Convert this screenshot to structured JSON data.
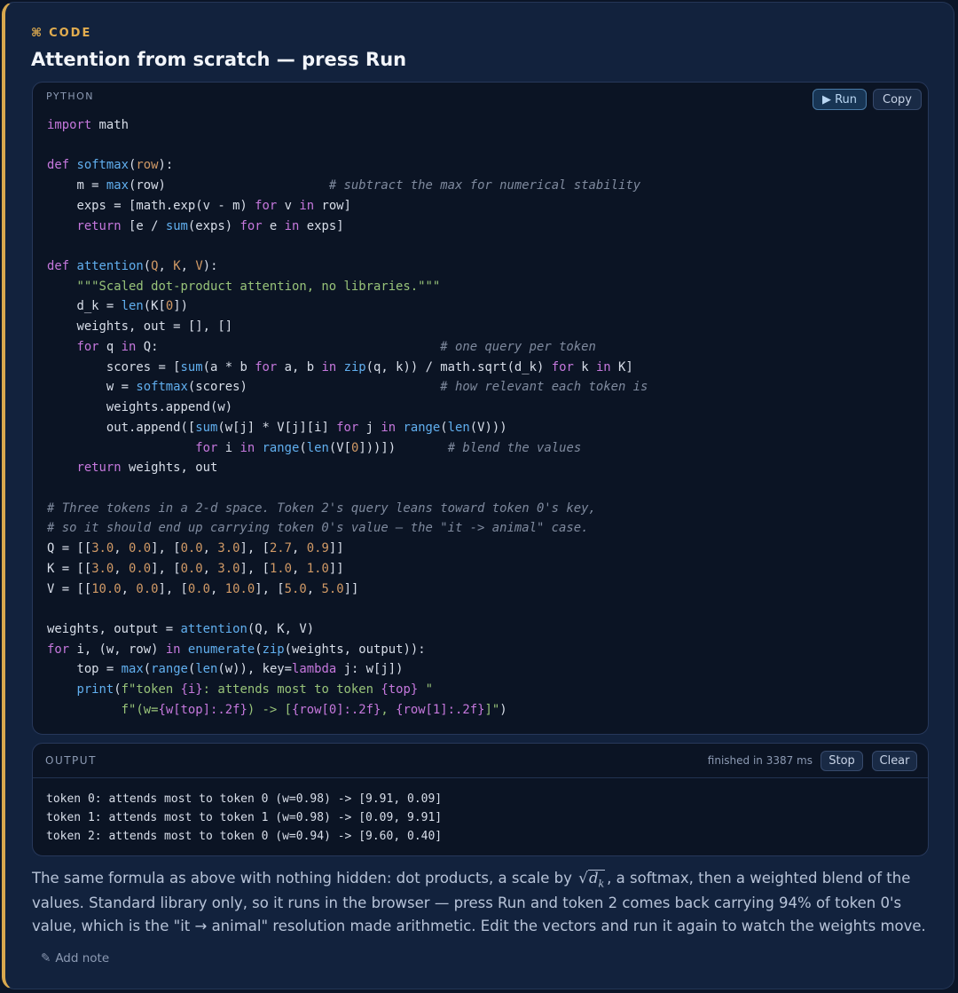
{
  "header": {
    "eyebrow_icon": "⌘",
    "eyebrow": "CODE",
    "title": "Attention from scratch — press Run"
  },
  "code_panel": {
    "language": "PYTHON",
    "run_label": "▶ Run",
    "copy_label": "Copy",
    "lines": [
      "import math",
      "",
      "def softmax(row):",
      "    m = max(row)                      # subtract the max for numerical stability",
      "    exps = [math.exp(v - m) for v in row]",
      "    return [e / sum(exps) for e in exps]",
      "",
      "def attention(Q, K, V):",
      "    \"\"\"Scaled dot-product attention, no libraries.\"\"\"",
      "    d_k = len(K[0])",
      "    weights, out = [], []",
      "    for q in Q:                                      # one query per token",
      "        scores = [sum(a * b for a, b in zip(q, k)) / math.sqrt(d_k) for k in K]",
      "        w = softmax(scores)                          # how relevant each token is",
      "        weights.append(w)",
      "        out.append([sum(w[j] * V[j][i] for j in range(len(V)))",
      "                    for i in range(len(V[0]))])       # blend the values",
      "    return weights, out",
      "",
      "# Three tokens in a 2-d space. Token 2's query leans toward token 0's key,",
      "# so it should end up carrying token 0's value — the \"it -> animal\" case.",
      "Q = [[3.0, 0.0], [0.0, 3.0], [2.7, 0.9]]",
      "K = [[3.0, 0.0], [0.0, 3.0], [1.0, 1.0]]",
      "V = [[10.0, 0.0], [0.0, 10.0], [5.0, 5.0]]",
      "",
      "weights, output = attention(Q, K, V)",
      "for i, (w, row) in enumerate(zip(weights, output)):",
      "    top = max(range(len(w)), key=lambda j: w[j])",
      "    print(f\"token {i}: attends most to token {top} \"",
      "          f\"(w={w[top]:.2f}) -> [{row[0]:.2f}, {row[1]:.2f}]\")"
    ]
  },
  "output_panel": {
    "label": "OUTPUT",
    "status": "finished in 3387 ms",
    "stop_label": "Stop",
    "clear_label": "Clear",
    "lines": [
      "token 0: attends most to token 0 (w=0.98) -> [9.91, 0.09]",
      "token 1: attends most to token 1 (w=0.98) -> [0.09, 9.91]",
      "token 2: attends most to token 0 (w=0.94) -> [9.60, 0.40]"
    ]
  },
  "prose": {
    "before_formula": "The same formula as above with nothing hidden: dot products, a scale by ",
    "formula_radical": "√",
    "formula_var": "d",
    "formula_sub": "k",
    "after_formula": ", a softmax, then a weighted blend of the values. Standard library only, so it runs in the browser — press Run and token 2 comes back carrying 94% of token 0's value, which is the \"it → animal\" resolution made arithmetic. Edit the vectors and run it again to watch the weights move."
  },
  "footer": {
    "add_note_icon": "✎",
    "add_note_label": "Add note"
  },
  "colors": {
    "accent": "#e2ad4f",
    "keyword": "#c678dd",
    "function": "#61afef",
    "number": "#d19a66",
    "string": "#98c379",
    "comment": "#7f8a9e"
  }
}
